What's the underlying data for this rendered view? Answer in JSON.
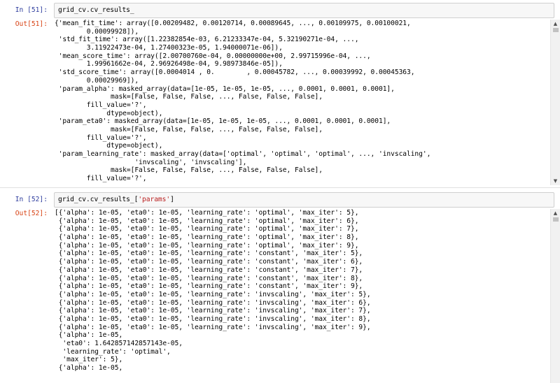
{
  "cells": [
    {
      "in_prompt": "In [51]:",
      "in_code": "grid_cv.cv_results_",
      "out_prompt": "Out[51]:",
      "out_lines": [
        "{'mean_fit_time': array([0.00209482, 0.00120714, 0.00089645, ..., 0.00109975, 0.00100021,",
        "        0.00099928]),",
        " 'std_fit_time': array([1.22382854e-03, 6.21233347e-04, 5.32190271e-04, ...,",
        "        3.11922473e-04, 1.27400323e-05, 1.94000071e-06]),",
        " 'mean_score_time': array([2.00700760e-04, 0.00000000e+00, 2.99715996e-04, ...,",
        "        1.99961662e-04, 2.96926498e-04, 9.98973846e-05]),",
        " 'std_score_time': array([0.0004014 , 0.        , 0.00045782, ..., 0.00039992, 0.00045363,",
        "        0.00029969]),",
        " 'param_alpha': masked_array(data=[1e-05, 1e-05, 1e-05, ..., 0.0001, 0.0001, 0.0001],",
        "              mask=[False, False, False, ..., False, False, False],",
        "        fill_value='?',",
        "             dtype=object),",
        " 'param_eta0': masked_array(data=[1e-05, 1e-05, 1e-05, ..., 0.0001, 0.0001, 0.0001],",
        "              mask=[False, False, False, ..., False, False, False],",
        "        fill_value='?',",
        "             dtype=object),",
        " 'param_learning_rate': masked_array(data=['optimal', 'optimal', 'optimal', ..., 'invscaling',",
        "                    'invscaling', 'invscaling'],",
        "              mask=[False, False, False, ..., False, False, False],",
        "        fill_value='?',"
      ]
    },
    {
      "in_prompt": "In [52]:",
      "in_code_prefix": "grid_cv.cv_results_[",
      "in_code_string": "'params'",
      "in_code_suffix": "]",
      "out_prompt": "Out[52]:",
      "out_lines": [
        "[{'alpha': 1e-05, 'eta0': 1e-05, 'learning_rate': 'optimal', 'max_iter': 5},",
        " {'alpha': 1e-05, 'eta0': 1e-05, 'learning_rate': 'optimal', 'max_iter': 6},",
        " {'alpha': 1e-05, 'eta0': 1e-05, 'learning_rate': 'optimal', 'max_iter': 7},",
        " {'alpha': 1e-05, 'eta0': 1e-05, 'learning_rate': 'optimal', 'max_iter': 8},",
        " {'alpha': 1e-05, 'eta0': 1e-05, 'learning_rate': 'optimal', 'max_iter': 9},",
        " {'alpha': 1e-05, 'eta0': 1e-05, 'learning_rate': 'constant', 'max_iter': 5},",
        " {'alpha': 1e-05, 'eta0': 1e-05, 'learning_rate': 'constant', 'max_iter': 6},",
        " {'alpha': 1e-05, 'eta0': 1e-05, 'learning_rate': 'constant', 'max_iter': 7},",
        " {'alpha': 1e-05, 'eta0': 1e-05, 'learning_rate': 'constant', 'max_iter': 8},",
        " {'alpha': 1e-05, 'eta0': 1e-05, 'learning_rate': 'constant', 'max_iter': 9},",
        " {'alpha': 1e-05, 'eta0': 1e-05, 'learning_rate': 'invscaling', 'max_iter': 5},",
        " {'alpha': 1e-05, 'eta0': 1e-05, 'learning_rate': 'invscaling', 'max_iter': 6},",
        " {'alpha': 1e-05, 'eta0': 1e-05, 'learning_rate': 'invscaling', 'max_iter': 7},",
        " {'alpha': 1e-05, 'eta0': 1e-05, 'learning_rate': 'invscaling', 'max_iter': 8},",
        " {'alpha': 1e-05, 'eta0': 1e-05, 'learning_rate': 'invscaling', 'max_iter': 9},",
        " {'alpha': 1e-05,",
        "  'eta0': 1.642857142857143e-05,",
        "  'learning_rate': 'optimal',",
        "  'max_iter': 5},",
        " {'alpha': 1e-05,"
      ]
    }
  ],
  "colors": {
    "in_prompt": "#303f9f",
    "out_prompt": "#d84315",
    "string": "#ba2121",
    "cell_bg": "#f7f7f7"
  },
  "icons": {
    "scroll_up": "scroll-up-arrow-icon",
    "scroll_down": "scroll-down-arrow-icon"
  }
}
